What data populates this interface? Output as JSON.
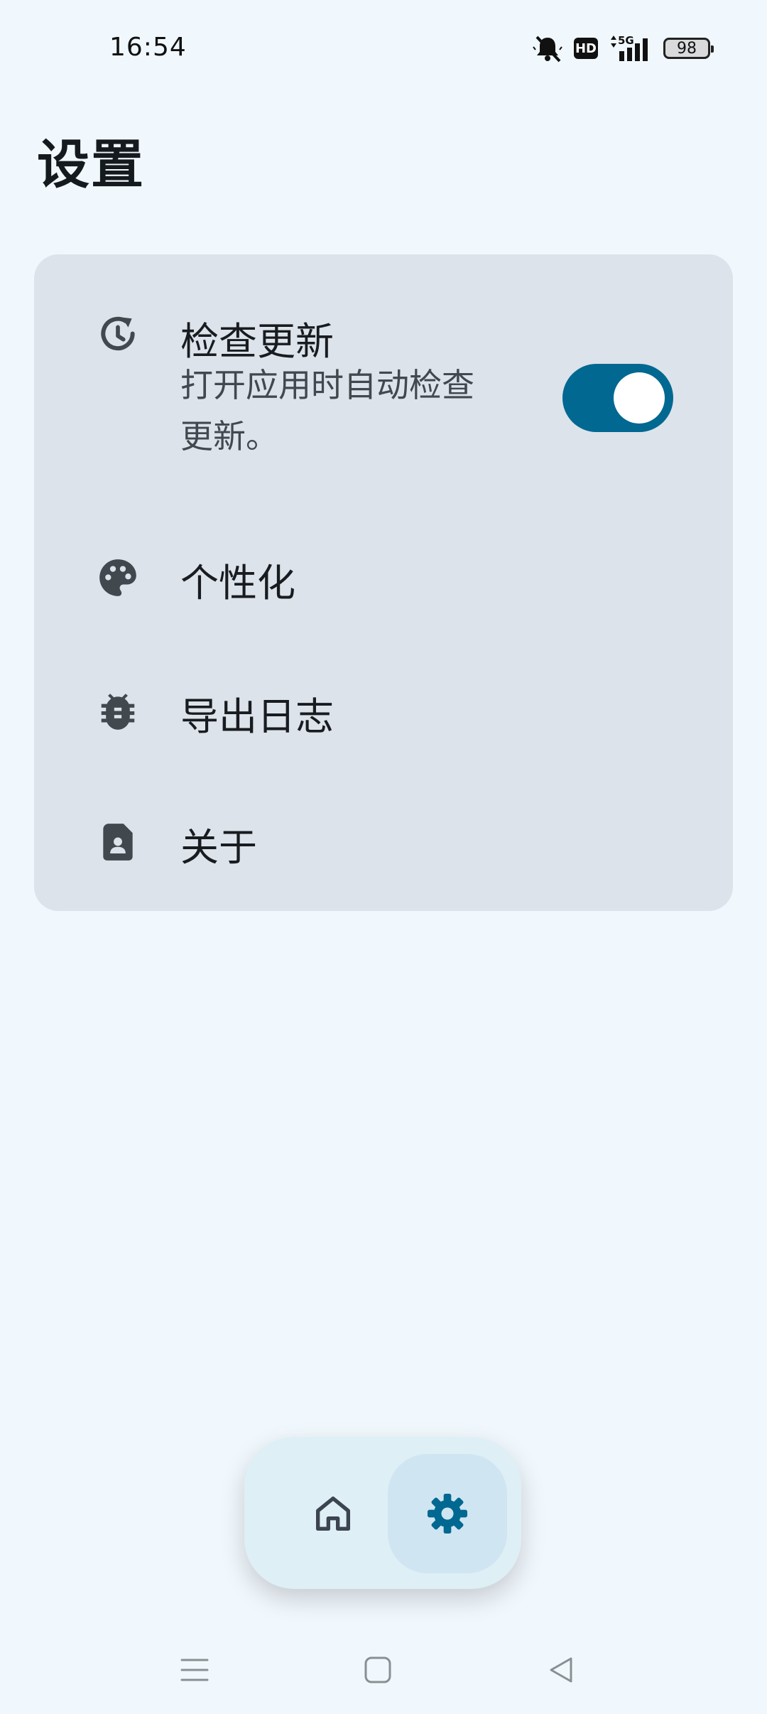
{
  "status_bar": {
    "time": "16:54",
    "hd_label": "HD",
    "network_label": "5G",
    "battery_level": "98",
    "icons": [
      "bell-muted-icon",
      "hd-icon",
      "signal-5g-icon",
      "battery-icon"
    ]
  },
  "page": {
    "title": "设置"
  },
  "settings": {
    "items": [
      {
        "icon": "update-clock-icon",
        "title": "检查更新",
        "subtitle_line1": "打开应用时自动检查",
        "subtitle_line2": "更新。",
        "toggle_on": true
      },
      {
        "icon": "palette-icon",
        "title": "个性化"
      },
      {
        "icon": "bug-icon",
        "title": "导出日志"
      },
      {
        "icon": "contact-file-icon",
        "title": "关于"
      }
    ]
  },
  "bottom_nav": {
    "items": [
      {
        "icon": "home-icon",
        "selected": false
      },
      {
        "icon": "gear-icon",
        "selected": true
      }
    ]
  },
  "system_nav": {
    "icons": [
      "menu-icon",
      "home-square-icon",
      "back-icon"
    ]
  },
  "colors": {
    "background": "#f1f8fd",
    "card": "#dde3ea",
    "accent": "#006891",
    "nav_bg": "#deeff5",
    "nav_selected": "#d0e5f2"
  }
}
